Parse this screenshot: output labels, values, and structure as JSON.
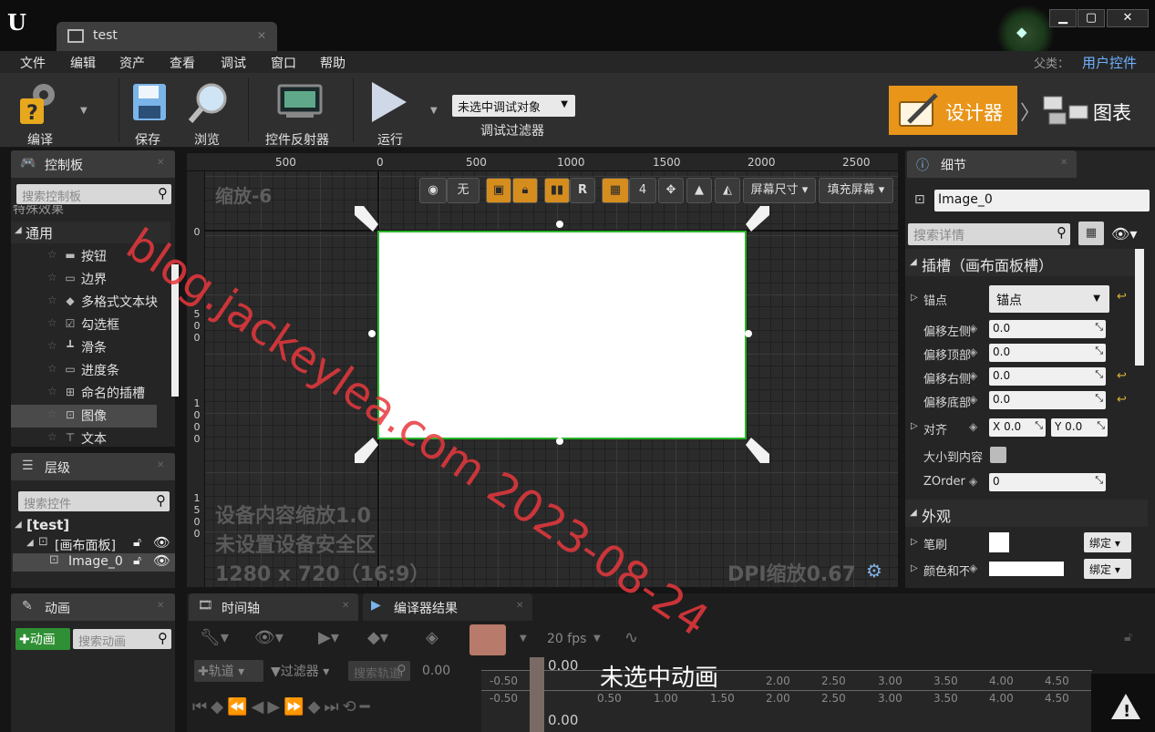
{
  "tab": {
    "label": "test"
  },
  "menu": [
    "文件",
    "编辑",
    "资产",
    "查看",
    "调试",
    "窗口",
    "帮助"
  ],
  "parent": {
    "label": "父类：",
    "value": "用户控件"
  },
  "toolbar": {
    "compile": "编译",
    "save": "保存",
    "browse": "浏览",
    "reflector": "控件反射器",
    "play": "运行",
    "debug_select": "未选中调试对象",
    "debug_filter": "调试过滤器",
    "designer": "设计器",
    "graph": "图表"
  },
  "palette": {
    "title": "控制板",
    "search_placeholder": "搜索控制板",
    "cut_item": "特殊效果",
    "category": "通用",
    "items": [
      "按钮",
      "边界",
      "多格式文本块",
      "勾选框",
      "滑条",
      "进度条",
      "命名的插槽",
      "图像",
      "文本"
    ]
  },
  "hierarchy": {
    "title": "层级",
    "search_placeholder": "搜索控件",
    "root": "[test]",
    "canvas": "[画布面板]",
    "image": "Image_0"
  },
  "canvas": {
    "ruler_top": [
      "500",
      "0",
      "500",
      "1000",
      "1500",
      "2000",
      "2500"
    ],
    "ruler_left_0": "0",
    "ruler_left_500": [
      "5",
      "0",
      "0"
    ],
    "ruler_left_1000": [
      "1",
      "0",
      "0",
      "0"
    ],
    "ruler_left_1500": [
      "1",
      "5",
      "0",
      "0"
    ],
    "zoom": "缩放-6",
    "toolbar": {
      "none": "无",
      "r": "R",
      "grid_num": "4",
      "screen_size": "屏幕尺寸",
      "fill_screen": "填充屏幕"
    },
    "device_scale": "设备内容缩放1.0",
    "safe_zone": "未设置设备安全区",
    "resolution": "1280 x 720（16:9）",
    "dpi": "DPI缩放0.67"
  },
  "details": {
    "title": "细节",
    "name_value": "Image_0",
    "search_placeholder": "搜索详情",
    "slot_section": "插槽（画布面板槽）",
    "anchor_label": "锚点",
    "anchor_value": "锚点",
    "offset_left": "偏移左侧",
    "offset_top": "偏移顶部",
    "offset_right": "偏移右侧",
    "offset_bottom": "偏移底部",
    "zero": "0.0",
    "align_label": "对齐",
    "align_x_label": "X",
    "align_y_label": "Y",
    "size_to_content": "大小到内容",
    "zorder_label": "ZOrder",
    "zorder_value": "0",
    "appearance_section": "外观",
    "brush_label": "笔刷",
    "color_label": "颜色和不透明度",
    "bind": "绑定"
  },
  "animation": {
    "title": "动画",
    "add_button": "动画",
    "search_placeholder": "搜索动画"
  },
  "timeline": {
    "tab_timeline": "时间轴",
    "tab_compiler": "编译器结果",
    "fps": "20 fps",
    "track_button": "轨道",
    "filter_button": "过滤器",
    "search_placeholder": "搜索轨道",
    "time_value": "0.00",
    "playhead_top": "0.00",
    "playhead_bottom": "0.00",
    "no_animation": "未选中动画",
    "ticks": [
      "-0.50",
      "0.50",
      "1.00",
      "1.50",
      "2.00",
      "2.50",
      "3.00",
      "3.50",
      "4.00",
      "4.50"
    ]
  },
  "watermark": "blog.jackeylea.com 2023-08-24",
  "colors": {
    "accent": "#e8951a",
    "selection": "#27b527",
    "link": "#6fb1ff",
    "watermark": "#e8383d"
  }
}
